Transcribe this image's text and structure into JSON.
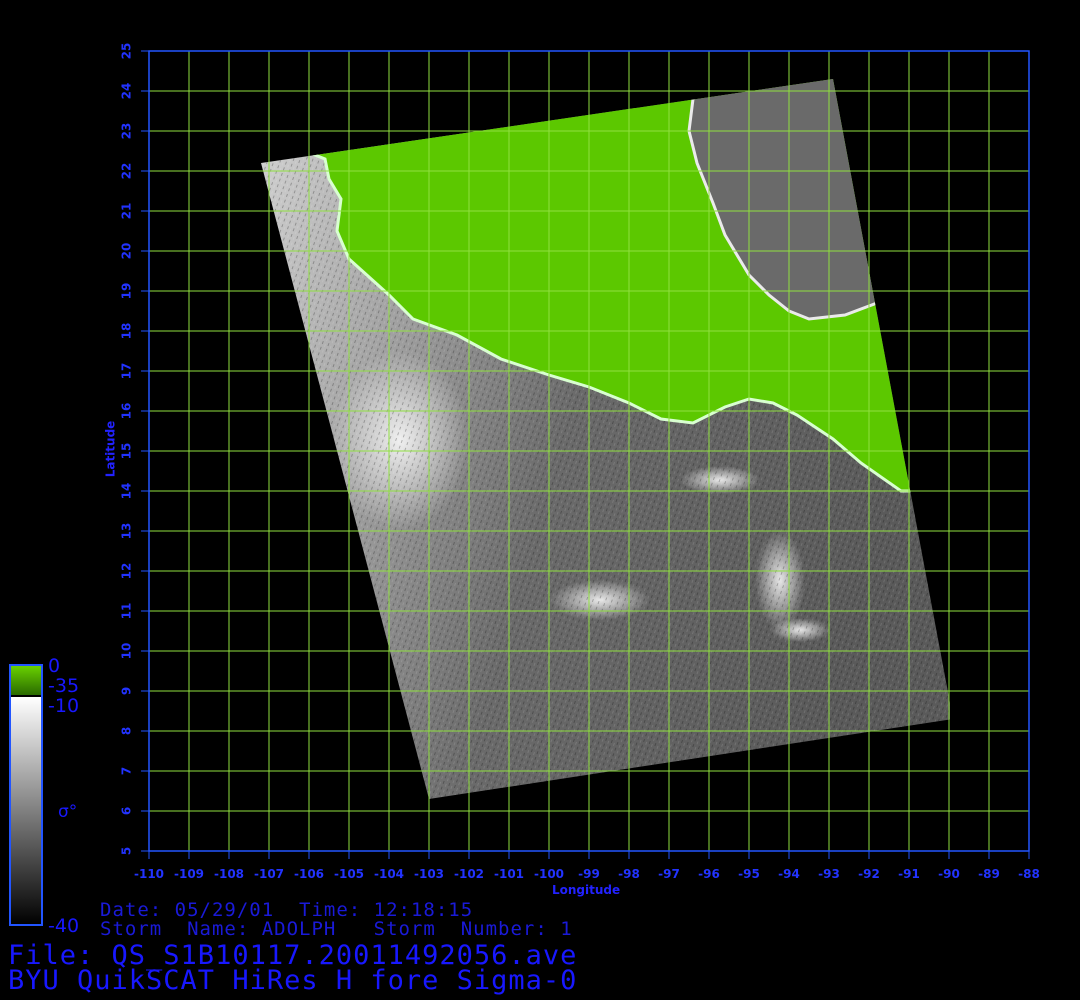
{
  "map": {
    "xlabel": "Longitude",
    "ylabel": "Latitude",
    "lon_range": [
      -110,
      -88
    ],
    "lat_range": [
      5,
      25
    ],
    "lon_ticks": [
      "-110",
      "-109",
      "-108",
      "-107",
      "-106",
      "-105",
      "-104",
      "-103",
      "-102",
      "-101",
      "-100",
      "-99",
      "-98",
      "-97",
      "-96",
      "-95",
      "-94",
      "-93",
      "-92",
      "-91",
      "-90",
      "-89",
      "-88"
    ],
    "lat_ticks": [
      "5",
      "6",
      "7",
      "8",
      "9",
      "10",
      "11",
      "12",
      "13",
      "14",
      "15",
      "16",
      "17",
      "18",
      "19",
      "20",
      "21",
      "22",
      "23",
      "24",
      "25"
    ],
    "grid": true,
    "grid_color": "#90e040",
    "frame_color": "#2255ff",
    "land_color": "#5cc800",
    "swath_corners_lonlat": [
      [
        -107.2,
        22.2
      ],
      [
        -92.9,
        24.3
      ],
      [
        -89.9,
        8.3
      ],
      [
        -103.0,
        6.3
      ]
    ],
    "coastline_lonlat": [
      [
        -106.1,
        22.5
      ],
      [
        -105.6,
        22.3
      ],
      [
        -105.5,
        21.8
      ],
      [
        -105.2,
        21.3
      ],
      [
        -105.3,
        20.5
      ],
      [
        -105.0,
        19.8
      ],
      [
        -104.0,
        18.9
      ],
      [
        -103.4,
        18.3
      ],
      [
        -102.3,
        17.9
      ],
      [
        -101.2,
        17.3
      ],
      [
        -100.0,
        16.9
      ],
      [
        -99.0,
        16.6
      ],
      [
        -98.0,
        16.2
      ],
      [
        -97.2,
        15.8
      ],
      [
        -96.4,
        15.7
      ],
      [
        -95.6,
        16.1
      ],
      [
        -95.0,
        16.3
      ],
      [
        -94.4,
        16.2
      ],
      [
        -93.8,
        15.9
      ],
      [
        -92.9,
        15.3
      ],
      [
        -92.2,
        14.7
      ],
      [
        -91.2,
        14.0
      ]
    ],
    "gulf_coast_lonlat": [
      [
        -96.4,
        23.8
      ],
      [
        -96.5,
        23.0
      ],
      [
        -96.3,
        22.2
      ],
      [
        -95.9,
        21.2
      ],
      [
        -95.6,
        20.4
      ],
      [
        -95.0,
        19.4
      ],
      [
        -94.5,
        18.9
      ],
      [
        -94.0,
        18.5
      ],
      [
        -93.5,
        18.3
      ],
      [
        -92.6,
        18.4
      ],
      [
        -91.8,
        18.7
      ]
    ]
  },
  "colorbar": {
    "land_top_label": "0",
    "land_bottom_label": "-35",
    "top_label": "-10",
    "bottom_label": "-40",
    "symbol": "σ°"
  },
  "info": {
    "date_line": "Date: 05/29/01  Time: 12:18:15",
    "storm_line": "Storm  Name: ADOLPH   Storm  Number: 1",
    "file_line": "File: QS_S1B10117.20011492056.ave",
    "title_line": "BYU QuikSCAT HiRes H fore Sigma-0"
  }
}
